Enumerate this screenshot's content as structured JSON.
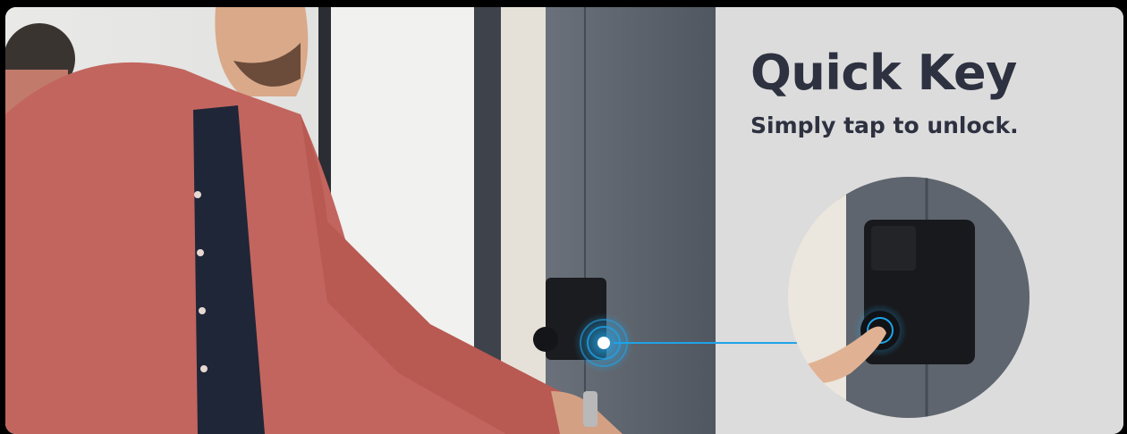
{
  "feature": {
    "title": "Quick Key",
    "subtitle": "Simply tap to unlock."
  },
  "colors": {
    "accent": "#1fa3e8",
    "text": "#2d3140",
    "panel": "#dcdcdc",
    "door": "#5f6670",
    "shirt": "#c2655e"
  },
  "icons": {
    "tap_point": "nfc-tap-ripple-icon",
    "connector": "connector-line"
  }
}
